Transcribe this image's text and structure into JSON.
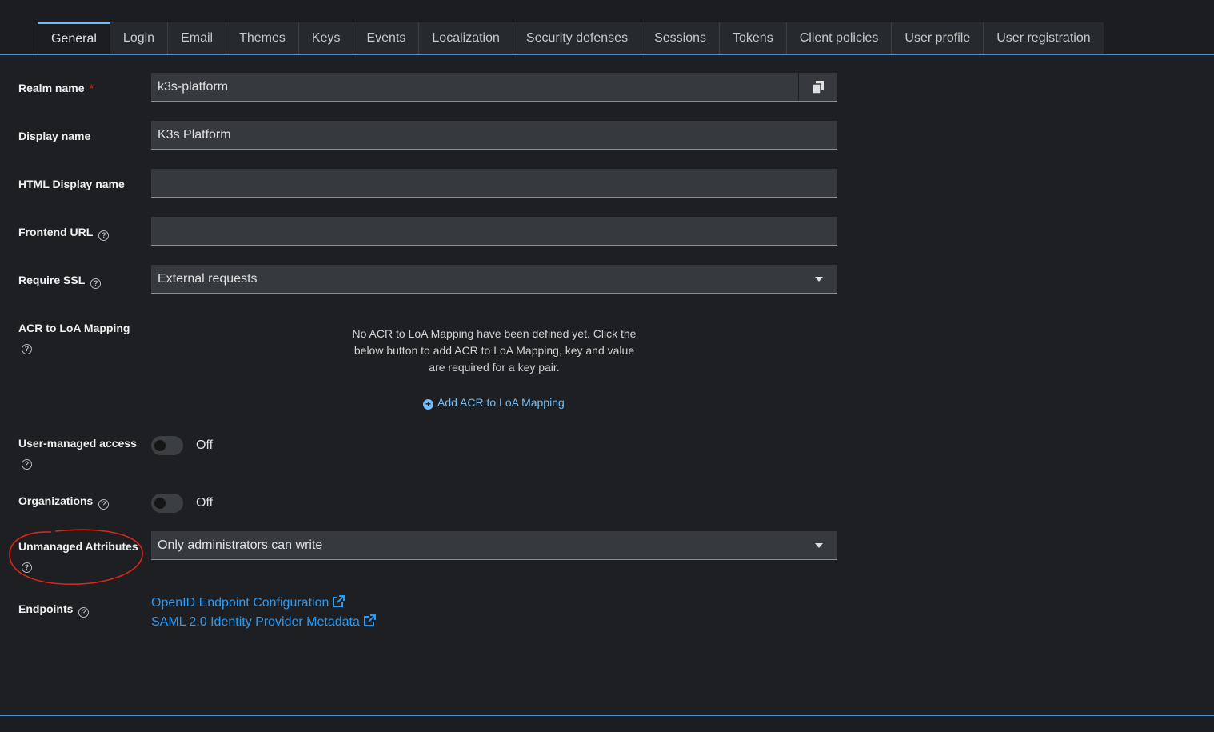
{
  "tabs": [
    "General",
    "Login",
    "Email",
    "Themes",
    "Keys",
    "Events",
    "Localization",
    "Security defenses",
    "Sessions",
    "Tokens",
    "Client policies",
    "User profile",
    "User registration"
  ],
  "form": {
    "realm_name": {
      "label": "Realm name",
      "required_mark": "*",
      "value": "k3s-platform"
    },
    "display_name": {
      "label": "Display name",
      "value": "K3s Platform"
    },
    "html_display_name": {
      "label": "HTML Display name",
      "value": ""
    },
    "frontend_url": {
      "label": "Frontend URL",
      "value": ""
    },
    "require_ssl": {
      "label": "Require SSL",
      "value": "External requests"
    },
    "acr_loa": {
      "label": "ACR to LoA Mapping",
      "empty_text": "No ACR to LoA Mapping have been defined yet. Click the below button to add ACR to LoA Mapping, key and value are required for a key pair.",
      "add_label": "Add ACR to LoA Mapping"
    },
    "user_managed_access": {
      "label": "User-managed access",
      "state": "Off",
      "on": false
    },
    "organizations": {
      "label": "Organizations",
      "state": "Off",
      "on": false
    },
    "unmanaged_attributes": {
      "label": "Unmanaged Attributes",
      "value": "Only administrators can write"
    },
    "endpoints": {
      "label": "Endpoints",
      "links": [
        "OpenID Endpoint Configuration",
        "SAML 2.0 Identity Provider Metadata"
      ]
    }
  },
  "colors": {
    "accent": "#73bcf7",
    "link": "#2b9af3",
    "required": "#c9190b",
    "annotation": "#d9261c",
    "background": "#1e1f22",
    "input_bg": "#36393d"
  }
}
